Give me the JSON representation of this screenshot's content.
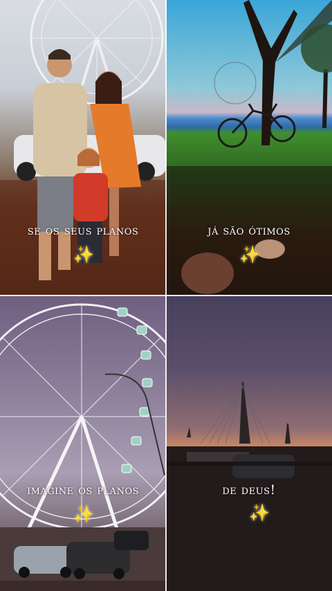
{
  "tiles": [
    {
      "caption": "se os seus planos",
      "sparkle": "✨"
    },
    {
      "caption": "já são ótimos",
      "sparkle": "✨"
    },
    {
      "caption": "imagine os planos",
      "sparkle": "✨"
    },
    {
      "caption": "de deus!",
      "sparkle": "✨"
    }
  ],
  "colors": {
    "caption_text": "#ffffff",
    "sparkle": "#ffd54a"
  }
}
